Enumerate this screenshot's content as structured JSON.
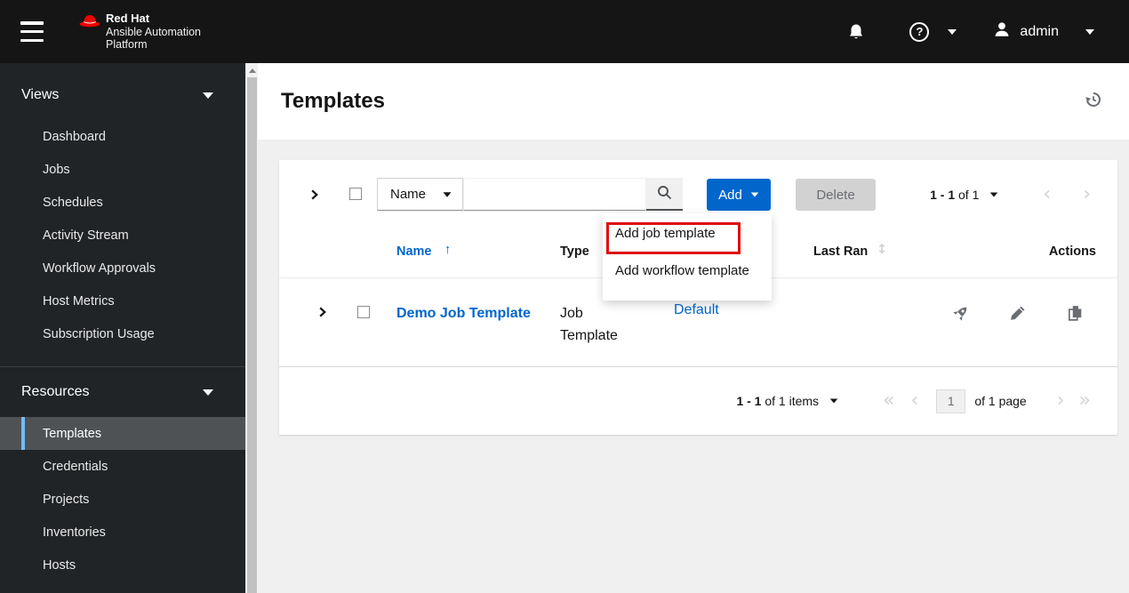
{
  "navbar": {
    "brand_line1": "Red Hat",
    "brand_line2": "Ansible Automation",
    "brand_line3": "Platform",
    "username": "admin"
  },
  "sidebar": {
    "groups": [
      {
        "label": "Views",
        "items": [
          {
            "label": "Dashboard"
          },
          {
            "label": "Jobs"
          },
          {
            "label": "Schedules"
          },
          {
            "label": "Activity Stream"
          },
          {
            "label": "Workflow Approvals"
          },
          {
            "label": "Host Metrics"
          },
          {
            "label": "Subscription Usage"
          }
        ]
      },
      {
        "label": "Resources",
        "items": [
          {
            "label": "Templates",
            "selected": true
          },
          {
            "label": "Credentials"
          },
          {
            "label": "Projects"
          },
          {
            "label": "Inventories"
          },
          {
            "label": "Hosts"
          }
        ]
      }
    ]
  },
  "page": {
    "title": "Templates"
  },
  "toolbar": {
    "filter_selected": "Name",
    "search_value": "",
    "add_label": "Add",
    "delete_label": "Delete",
    "range_bold": "1 - 1",
    "range_rest": "of 1"
  },
  "add_menu": {
    "item1": "Add job template",
    "item2": "Add workflow template"
  },
  "table": {
    "col_name": "Name",
    "col_type": "Type",
    "col_last_ran": "Last Ran",
    "col_actions": "Actions",
    "sort_up_glyph": "↑",
    "sort_updown_glyph": "↕",
    "row": {
      "name": "Demo Job Template",
      "type": "Job Template",
      "organization": "Default",
      "last_ran": ""
    }
  },
  "pagination": {
    "range_bold": "1 - 1",
    "range_rest": "of 1 items",
    "first_glyph": "«",
    "prev_glyph": "‹",
    "page": "1",
    "of_pages": "of 1 page",
    "next_glyph": "›",
    "last_glyph": "»"
  },
  "colors": {
    "accent": "#0066cc",
    "annotation": "#e00b0b",
    "selected_border": "#73bcf7",
    "navbar_bg": "#151515",
    "sidebar_bg": "#212427"
  }
}
